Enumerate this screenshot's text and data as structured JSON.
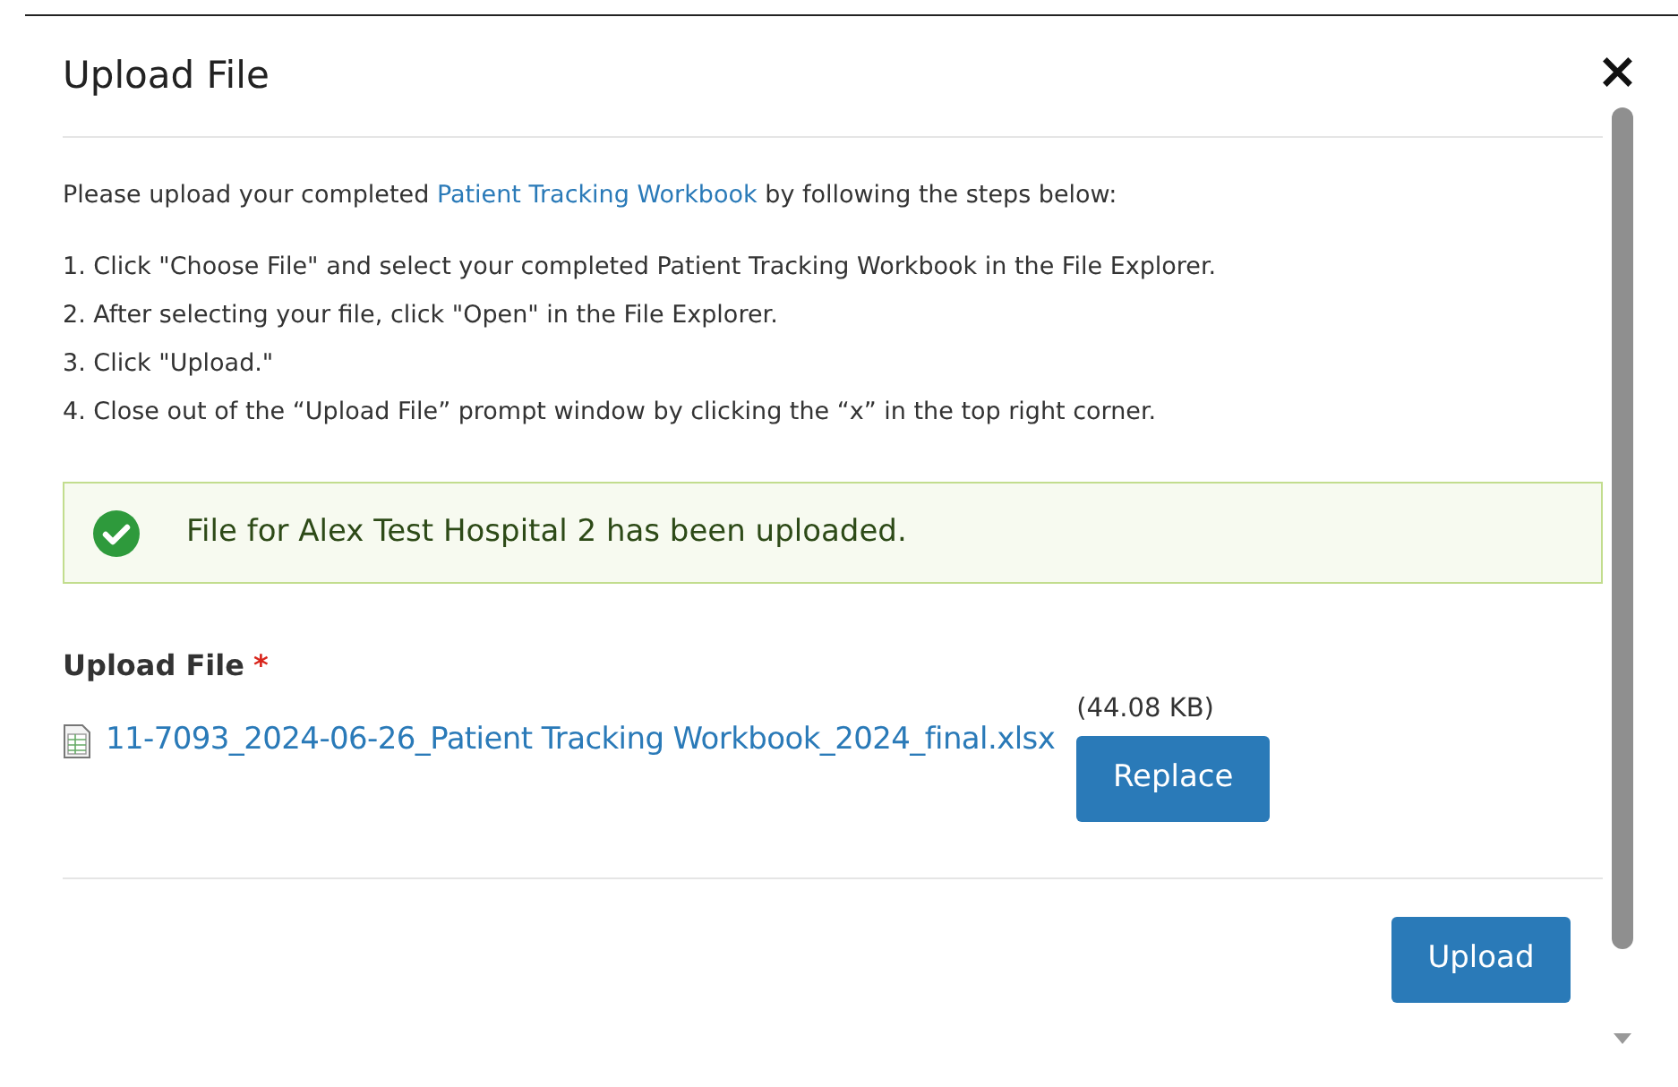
{
  "dialog": {
    "title": "Upload File",
    "close": "×"
  },
  "intro": {
    "before": "Please upload your completed ",
    "link": "Patient Tracking Workbook",
    "after": " by following the steps below:"
  },
  "steps": [
    "1. Click \"Choose File\" and select your completed Patient Tracking Workbook in the File Explorer.",
    "2. After selecting your file, click \"Open\" in the File Explorer.",
    "3. Click \"Upload.\"",
    "4. Close out of the “Upload File” prompt window by clicking the “x” in the top right corner."
  ],
  "alert": {
    "kind": "success",
    "message": "File for Alex Test Hospital 2 has been uploaded."
  },
  "field": {
    "label": "Upload File",
    "required_mark": "*",
    "file_name": "11-7093_2024-06-26_Patient Tracking Workbook_2024_final.xlsx",
    "file_size": "(44.08 KB)",
    "replace_button": "Replace"
  },
  "footer": {
    "upload_button": "Upload"
  }
}
